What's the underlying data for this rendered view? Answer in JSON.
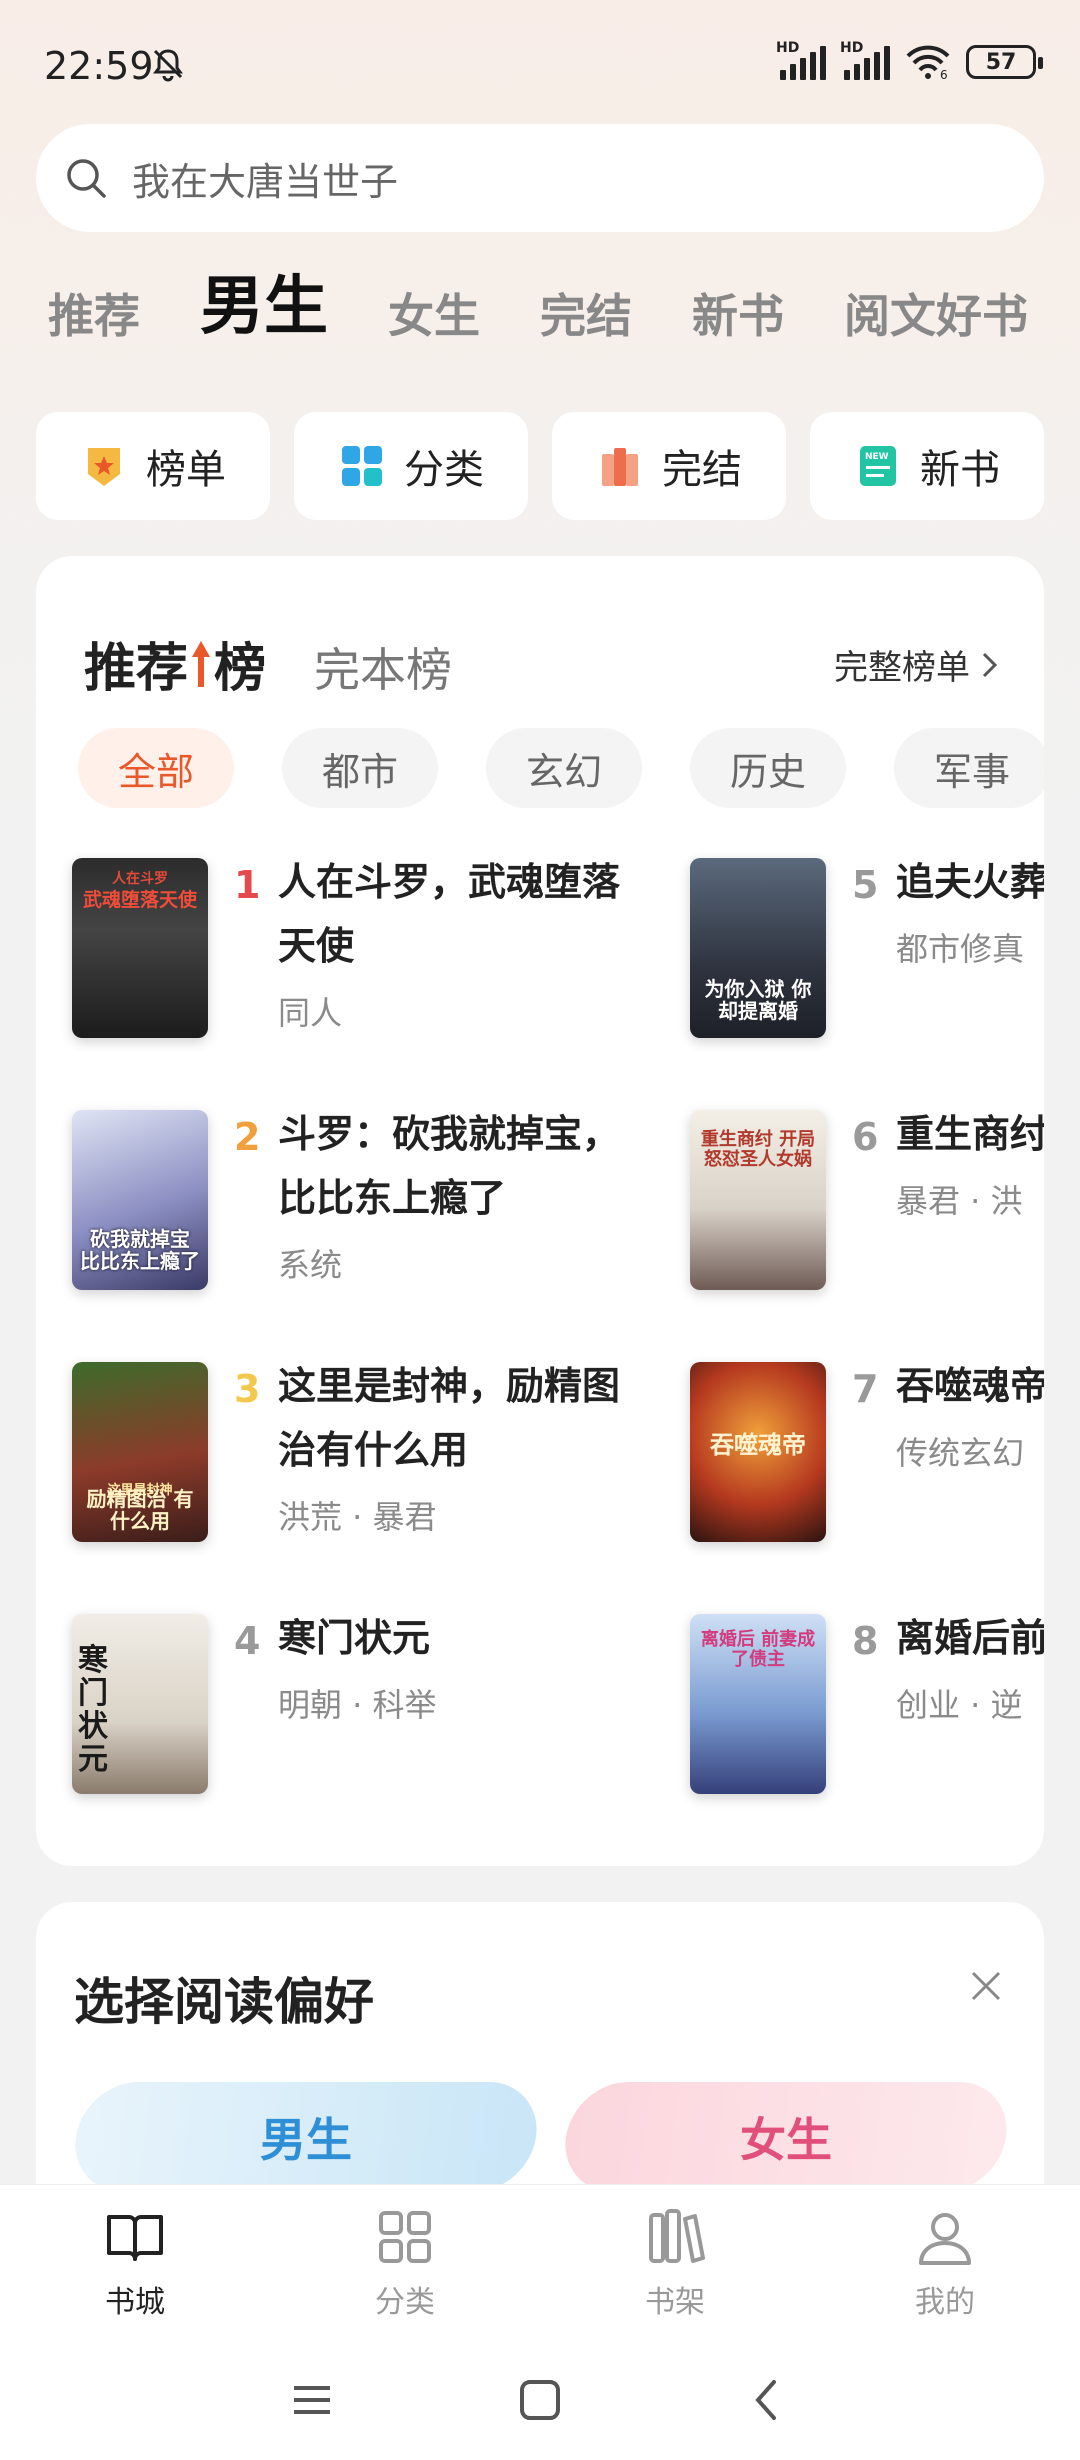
{
  "status": {
    "time": "22:59",
    "hd1": "HD",
    "hd2": "HD",
    "wifi_sub": "6",
    "battery": "57"
  },
  "search": {
    "placeholder": "我在大唐当世子"
  },
  "top_tabs": [
    "推荐",
    "男生",
    "女生",
    "完结",
    "新书",
    "阅文好书"
  ],
  "shortcuts": [
    {
      "label": "榜单",
      "icon": "medal-icon"
    },
    {
      "label": "分类",
      "icon": "grid-icon"
    },
    {
      "label": "完结",
      "icon": "books-icon"
    },
    {
      "label": "新书",
      "icon": "new-doc-icon"
    }
  ],
  "rank": {
    "title_a": "推荐",
    "title_b": "榜",
    "alt": "完本榜",
    "full_list": "完整榜单",
    "chips": [
      "全部",
      "都市",
      "玄幻",
      "历史",
      "军事"
    ],
    "books": [
      {
        "no": "1",
        "title": "人在斗罗，武魂堕落天使",
        "sub": "同人",
        "cover_text": "武魂堕落天使",
        "cover_top": "人在斗罗"
      },
      {
        "no": "2",
        "title": "斗罗：砍我就掉宝，比比东上瘾了",
        "sub": "系统",
        "cover_text": "砍我就掉宝 比比东上瘾了",
        "cover_top": ""
      },
      {
        "no": "3",
        "title": "这里是封神，励精图治有什么用",
        "sub": "洪荒 · 暴君",
        "cover_text": "励精图治 有什么用",
        "cover_top": "这里是封神"
      },
      {
        "no": "4",
        "title": "寒门状元",
        "sub": "明朝 · 科举",
        "cover_text": "寒门状元",
        "cover_top": ""
      },
      {
        "no": "5",
        "title": "追夫火葬场，老婆后悔",
        "sub": "都市修真",
        "cover_text": "为你入狱 你却提离婚",
        "cover_top": ""
      },
      {
        "no": "6",
        "title": "重生商纣，怼圣人女",
        "sub": "暴君 · 洪",
        "cover_text": "重生商纣 开局怒怼圣人女娲",
        "cover_top": ""
      },
      {
        "no": "7",
        "title": "吞噬魂帝",
        "sub": "传统玄幻",
        "cover_text": "吞噬魂帝",
        "cover_top": ""
      },
      {
        "no": "8",
        "title": "离婚后前妻成了借主",
        "sub": "创业 · 逆",
        "cover_text": "离婚后 前妻成了债主",
        "cover_top": ""
      }
    ]
  },
  "pref": {
    "title": "选择阅读偏好",
    "male": "男生",
    "female": "女生"
  },
  "bottom_nav": [
    {
      "label": "书城",
      "icon": "book-open-icon"
    },
    {
      "label": "分类",
      "icon": "grid-icon"
    },
    {
      "label": "书架",
      "icon": "bookshelf-icon"
    },
    {
      "label": "我的",
      "icon": "user-icon"
    }
  ],
  "colors": {
    "accent": "#e8582a",
    "rank1": "#e5484d",
    "rank2": "#f0a03c",
    "rank3": "#f2c94c",
    "rank_other": "#9a9a9a"
  }
}
